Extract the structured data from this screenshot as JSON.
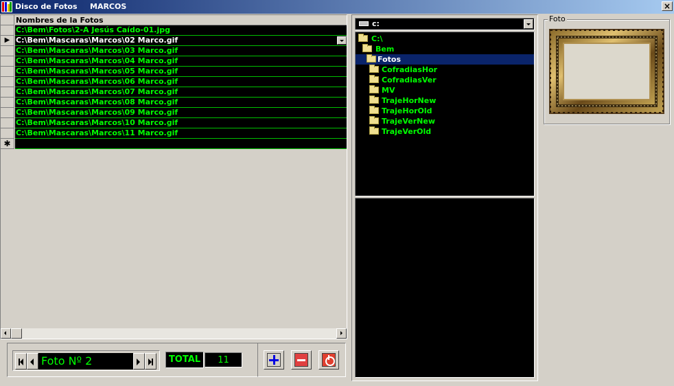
{
  "window": {
    "title": "Disco de Fotos",
    "subtitle": "MARCOS",
    "close_glyph": "×"
  },
  "grid": {
    "column_header": "Nombres de la Fotos",
    "rows": [
      "C:\\Bem\\Fotos\\2-A Jesús Caído-01.jpg",
      "C:\\Bem\\Mascaras\\Marcos\\02 Marco.gif",
      "C:\\Bem\\Mascaras\\Marcos\\03 Marco.gif",
      "C:\\Bem\\Mascaras\\Marcos\\04 Marco.gif",
      "C:\\Bem\\Mascaras\\Marcos\\05 Marco.gif",
      "C:\\Bem\\Mascaras\\Marcos\\06 Marco.gif",
      "C:\\Bem\\Mascaras\\Marcos\\07 Marco.gif",
      "C:\\Bem\\Mascaras\\Marcos\\08 Marco.gif",
      "C:\\Bem\\Mascaras\\Marcos\\09 Marco.gif",
      "C:\\Bem\\Mascaras\\Marcos\\10 Marco.gif",
      "C:\\Bem\\Mascaras\\Marcos\\11 Marco.gif"
    ],
    "current_row_marker": "▶",
    "new_row_marker": "✱"
  },
  "navigator": {
    "label": "Foto Nº 2",
    "total_label": "TOTAL",
    "total_value": "11"
  },
  "drive": {
    "label": "c:"
  },
  "dirs": {
    "items": [
      {
        "label": "C:\\",
        "level": 0
      },
      {
        "label": "Bem",
        "level": 1
      },
      {
        "label": "Fotos",
        "level": 2,
        "selected": true
      },
      {
        "label": "CofradiasHor",
        "level": 3
      },
      {
        "label": "CofradiasVer",
        "level": 3
      },
      {
        "label": "MV",
        "level": 3
      },
      {
        "label": "TrajeHorNew",
        "level": 3
      },
      {
        "label": "TrajeHorOld",
        "level": 3
      },
      {
        "label": "TrajeVerNew",
        "level": 3
      },
      {
        "label": "TrajeVerOld",
        "level": 3
      }
    ]
  },
  "foto": {
    "label": "Foto"
  },
  "colors": {
    "grid_text": "#00ff00",
    "grid_bg": "#000000",
    "selection": "#0a246a",
    "face": "#d4d0c8"
  }
}
